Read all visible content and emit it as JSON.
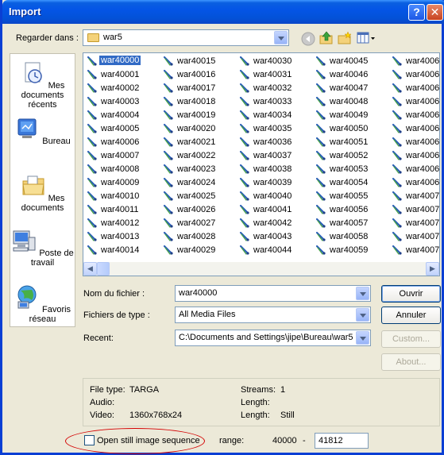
{
  "window": {
    "title": "Import",
    "help_glyph": "?",
    "close_glyph": "✕"
  },
  "lookin": {
    "label": "Regarder dans :",
    "value": "war5"
  },
  "toolbar": {
    "icons": [
      "back-icon",
      "up-folder-icon",
      "new-folder-icon",
      "view-menu-icon"
    ]
  },
  "places": [
    {
      "label": "Mes documents récents",
      "icon": "recent-documents-icon"
    },
    {
      "label": "Bureau",
      "icon": "desktop-icon"
    },
    {
      "label": "Mes documents",
      "icon": "my-documents-icon"
    },
    {
      "label": "Poste de travail",
      "icon": "my-computer-icon"
    },
    {
      "label": "Favoris réseau",
      "icon": "network-places-icon"
    }
  ],
  "files": {
    "columns": [
      [
        "war40000",
        "war40001",
        "war40002",
        "war40003",
        "war40004",
        "war40005",
        "war40006",
        "war40007",
        "war40008",
        "war40009",
        "war40010",
        "war40011",
        "war40012",
        "war40013",
        "war40014"
      ],
      [
        "war40015",
        "war40016",
        "war40017",
        "war40018",
        "war40019",
        "war40020",
        "war40021",
        "war40022",
        "war40023",
        "war40024",
        "war40025",
        "war40026",
        "war40027",
        "war40028",
        "war40029"
      ],
      [
        "war40030",
        "war40031",
        "war40032",
        "war40033",
        "war40034",
        "war40035",
        "war40036",
        "war40037",
        "war40038",
        "war40039",
        "war40040",
        "war40041",
        "war40042",
        "war40043",
        "war40044"
      ],
      [
        "war40045",
        "war40046",
        "war40047",
        "war40048",
        "war40049",
        "war40050",
        "war40051",
        "war40052",
        "war40053",
        "war40054",
        "war40055",
        "war40056",
        "war40057",
        "war40058",
        "war40059"
      ],
      [
        "war4006",
        "war4006",
        "war4006",
        "war4006",
        "war4006",
        "war4006",
        "war4006",
        "war4006",
        "war4006",
        "war4006",
        "war4007",
        "war4007",
        "war4007",
        "war4007",
        "war4007"
      ]
    ],
    "selected": "war40000",
    "scroll_left": "◀",
    "scroll_right": "▶"
  },
  "form": {
    "filename_label": "Nom du fichier :",
    "filename_value": "war40000",
    "filetype_label": "Fichiers de type :",
    "filetype_value": "All Media Files",
    "recent_label": "Recent:",
    "recent_value": "C:\\Documents and Settings\\jipe\\Bureau\\war5"
  },
  "buttons": {
    "open": "Ouvrir",
    "cancel": "Annuler",
    "custom": "Custom...",
    "about": "About..."
  },
  "info": {
    "filetype_label": "File type:",
    "filetype_value": "TARGA",
    "audio_label": "Audio:",
    "video_label": "Video:",
    "video_value": "1360x768x24",
    "streams_label": "Streams:",
    "streams_value": "1",
    "length1_label": "Length:",
    "length2_label": "Length:",
    "length2_value": "Still"
  },
  "sequence": {
    "checkbox_label": "Open still image sequence",
    "range_label": "range:",
    "range_start": "40000",
    "range_dash": "-",
    "range_end": "41812"
  }
}
